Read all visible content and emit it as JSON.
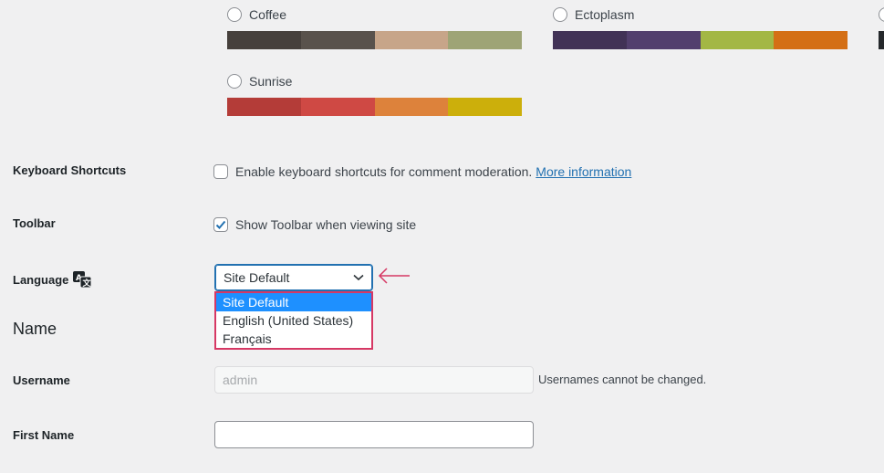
{
  "color_schemes": [
    {
      "name": "Coffee",
      "selected": false,
      "colors": [
        "#46403c",
        "#59524c",
        "#c7a589",
        "#9ea476"
      ]
    },
    {
      "name": "Ectoplasm",
      "selected": false,
      "colors": [
        "#413256",
        "#523f6d",
        "#a3b745",
        "#d46f15"
      ]
    },
    {
      "name": "Sunrise",
      "selected": false,
      "colors": [
        "#b43c38",
        "#cf4944",
        "#dd823b",
        "#ccaf0b"
      ]
    },
    {
      "name": "",
      "selected": false,
      "colors": [
        "#25282b"
      ]
    }
  ],
  "keyboard_shortcuts": {
    "label": "Keyboard Shortcuts",
    "checkbox_label": "Enable keyboard shortcuts for comment moderation.",
    "link": "More information",
    "checked": false
  },
  "toolbar": {
    "label": "Toolbar",
    "checkbox_label": "Show Toolbar when viewing site",
    "checked": true
  },
  "language": {
    "label": "Language",
    "icon": "translation-icon",
    "selected": "Site Default",
    "options": [
      "Site Default",
      "English (United States)",
      "Français"
    ],
    "highlighted_index": 0
  },
  "name_section": {
    "title": "Name",
    "username": {
      "label": "Username",
      "value": "admin",
      "hint": "Usernames cannot be changed.",
      "disabled": true
    },
    "first_name": {
      "label": "First Name",
      "value": ""
    }
  },
  "colors": {
    "accent": "#2271b1",
    "annotation": "#d63864",
    "highlight": "#1e90ff"
  }
}
